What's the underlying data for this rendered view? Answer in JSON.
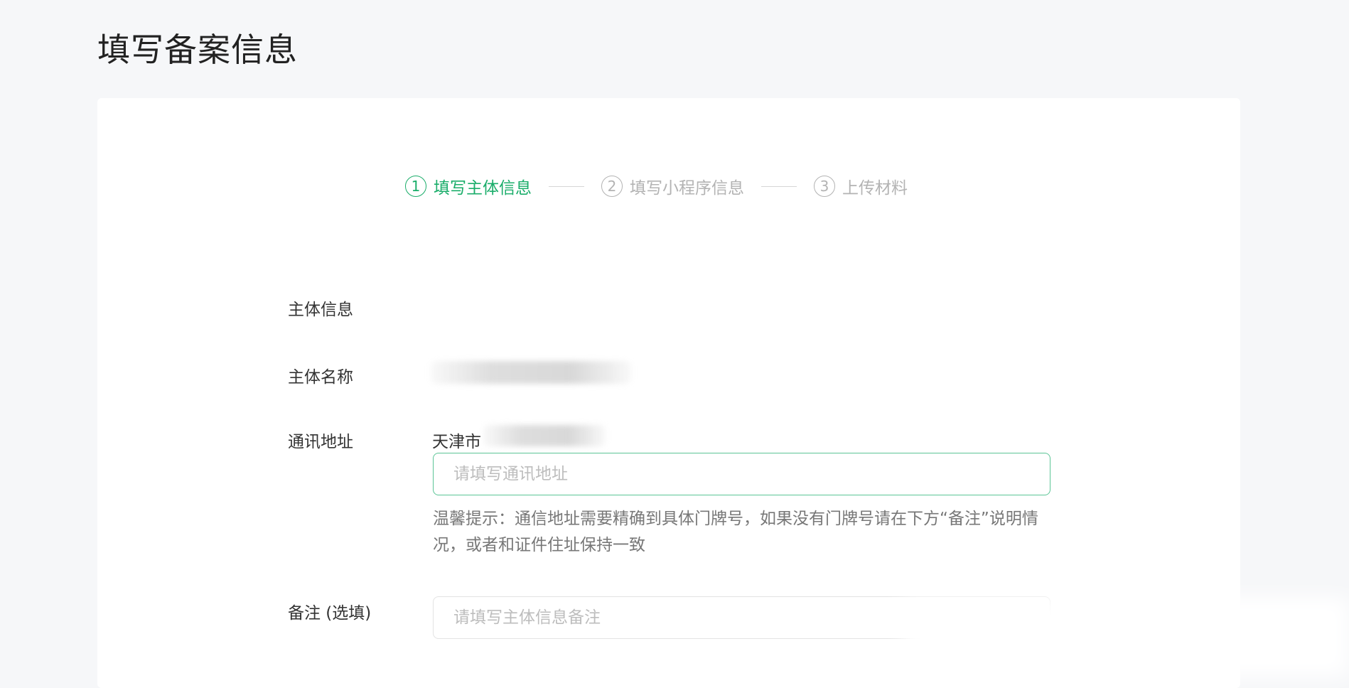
{
  "page": {
    "title": "填写备案信息"
  },
  "steps": [
    {
      "number": "1",
      "label": "填写主体信息",
      "state": "active"
    },
    {
      "number": "2",
      "label": "填写小程序信息",
      "state": "inactive"
    },
    {
      "number": "3",
      "label": "上传材料",
      "state": "inactive"
    }
  ],
  "form": {
    "section_title": "主体信息",
    "subject_name": {
      "label": "主体名称"
    },
    "address": {
      "label": "通讯地址",
      "city": "天津市",
      "placeholder": "请填写通讯地址",
      "hint": "温馨提示：通信地址需要精确到具体门牌号，如果没有门牌号请在下方“备注”说明情况，或者和证件住址保持一致"
    },
    "remark": {
      "label": "备注 (选填)",
      "placeholder": "请填写主体信息备注"
    }
  },
  "colors": {
    "accent": "#1aad6a",
    "inactive": "#b3b3b3",
    "background": "#f6f7f9"
  }
}
